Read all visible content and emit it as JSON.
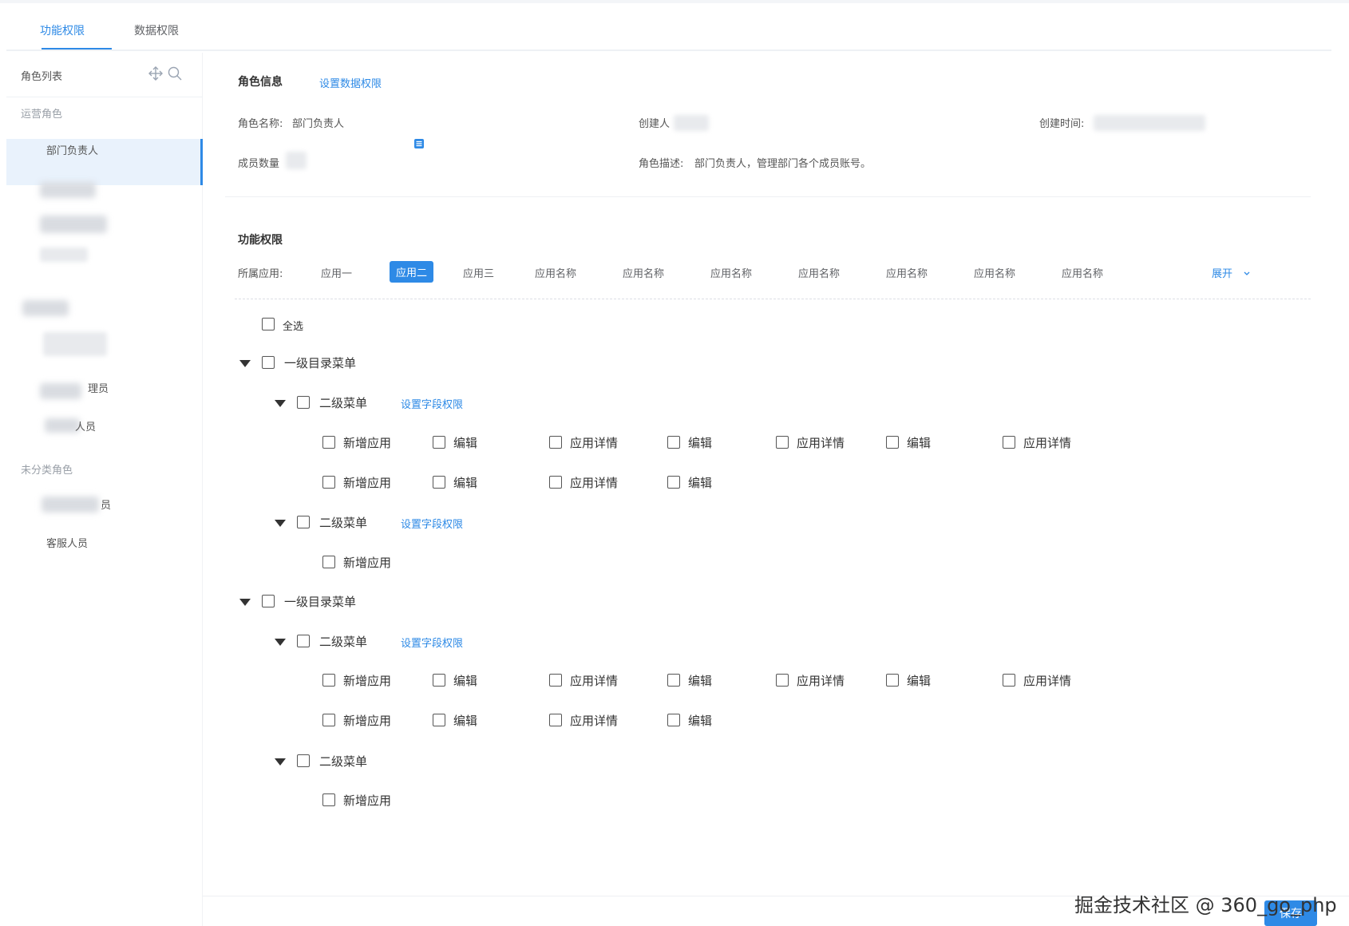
{
  "tabs": [
    {
      "label": "功能权限",
      "active": true
    },
    {
      "label": "数据权限",
      "active": false
    }
  ],
  "sidebar": {
    "title": "角色列表",
    "icons": [
      "move-icon",
      "search-icon"
    ],
    "group_operations": "运营角色",
    "item_active": "部门负责人",
    "item_partial_1": "理员",
    "item_partial_2": "人员",
    "group_uncategorized": "未分类角色",
    "item_partial_3": "员",
    "item_customer_service": "客服人员"
  },
  "role_info": {
    "title": "角色信息",
    "set_data_permission": "设置数据权限",
    "name_label": "角色名称:",
    "name_value": "部门负责人",
    "creator_label": "创建人",
    "created_time_label": "创建时间:",
    "member_count_label": "成员数量",
    "description_label": "角色描述:",
    "description_value": "部门负责人，管理部门各个成员账号。"
  },
  "function_permission": {
    "title": "功能权限",
    "app_label": "所属应用:",
    "apps": [
      "应用一",
      "应用二",
      "应用三",
      "应用名称",
      "应用名称",
      "应用名称",
      "应用名称",
      "应用名称",
      "应用名称",
      "应用名称"
    ],
    "active_app_index": 1,
    "expand_label": "展开",
    "select_all": "全选",
    "level1_label": "一级目录菜单",
    "level2_label": "二级菜单",
    "set_field_permission": "设置字段权限",
    "perm_row_full": [
      "新增应用",
      "编辑",
      "应用详情",
      "编辑",
      "应用详情",
      "编辑",
      "应用详情"
    ],
    "perm_row_short": [
      "新增应用",
      "编辑",
      "应用详情",
      "编辑"
    ],
    "perm_single": [
      "新增应用"
    ]
  },
  "footer": {
    "save_label": "保存",
    "watermark": "掘金技术社区 @ 360_go_php"
  },
  "colors": {
    "accent": "#2e8ae6",
    "active_bg": "#e9f2fc"
  }
}
